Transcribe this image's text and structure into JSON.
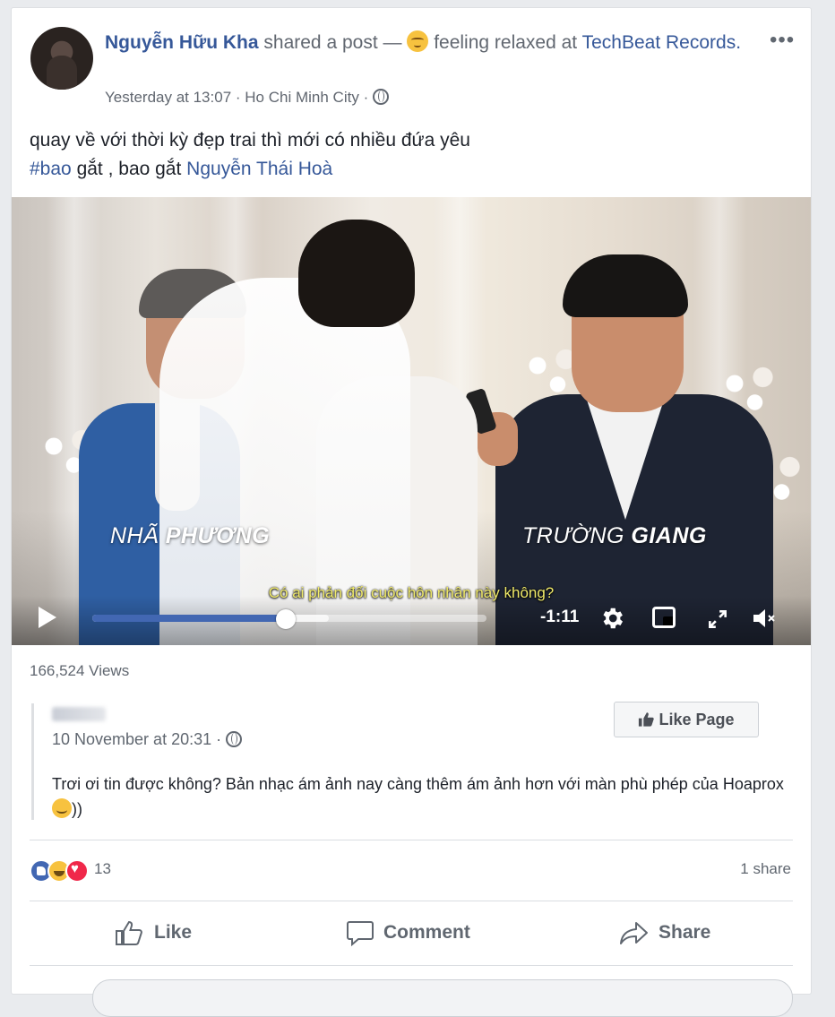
{
  "post": {
    "author": "Nguyễn Hữu Kha",
    "action": "shared a post —",
    "feeling": "feeling relaxed at",
    "place": "TechBeat Records.",
    "time": "Yesterday at 13:07",
    "location": "Ho Chi Minh City",
    "text_line1": "quay về với thời kỳ đẹp trai thì mới có nhiều đứa yêu",
    "hashtag": "#bao",
    "text_mid": "gắt , bao gắt",
    "mention": "Nguyễn Thái Hoà",
    "more_icon": "more-options-icon"
  },
  "video": {
    "name_left_light": "NHÃ ",
    "name_left_bold": "PHƯƠNG",
    "name_right_light": "TRƯỜNG ",
    "name_right_bold": "GIANG",
    "subtitle": "Có ai phản đối cuộc hôn nhân này không?",
    "time_left": "-1:11",
    "progress": 0.49,
    "buffered": 0.6
  },
  "stats": {
    "views": "166,524 Views",
    "reaction_count": "13",
    "shares": "1 share"
  },
  "shared": {
    "date": "10 November at 20:31",
    "body": "Trơi ơi tin được không? Bản nhạc ám ảnh nay càng thêm ám ảnh hơn với màn phù phép của Hoaprox",
    "body_end": "))",
    "like_page": "Like Page"
  },
  "actions": {
    "like": "Like",
    "comment": "Comment",
    "share": "Share"
  },
  "colors": {
    "link": "#365899",
    "accent": "#4267b2",
    "background": "#e9ebee"
  }
}
